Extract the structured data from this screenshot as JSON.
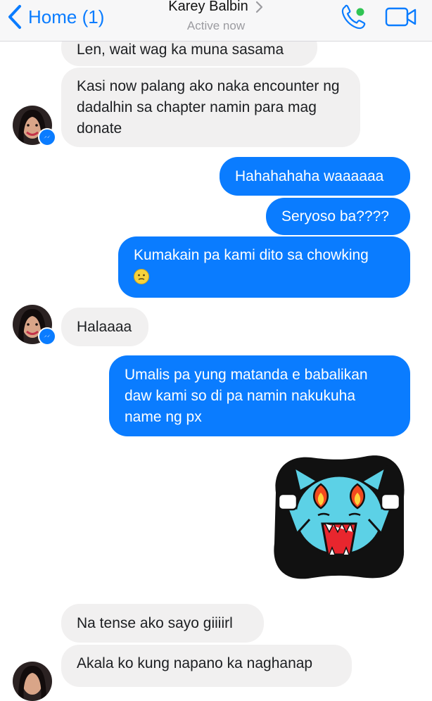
{
  "header": {
    "back_label": "Home (1)",
    "contact_name": "Karey Balbin",
    "status": "Active now"
  },
  "messages": [
    {
      "dir": "in",
      "text": "Len, wait wag ka muna sasama"
    },
    {
      "dir": "in",
      "text": "Kasi now palang ako naka encounter ng dadalhin sa chapter namin para mag donate"
    },
    {
      "dir": "out",
      "text": "Hahahahaha waaaaaa"
    },
    {
      "dir": "out",
      "text": "Seryoso ba????"
    },
    {
      "dir": "out",
      "text": "Kumakain pa kami dito sa chowking",
      "emoji": "confused-face"
    },
    {
      "dir": "in",
      "text": "Halaaaa"
    },
    {
      "dir": "out",
      "text": "Umalis pa yung matanda e babalikan daw kami so di pa namin nakukuha name ng px"
    },
    {
      "dir": "out",
      "sticker": "angry-cat-fire-eyes-sticker"
    },
    {
      "dir": "in",
      "text": "Na tense ako sayo giiiirl"
    },
    {
      "dir": "in",
      "text": "Akala ko kung napano ka naghanap"
    }
  ],
  "colors": {
    "accent": "#0a7cff",
    "incoming_bubble": "#f1f0f0",
    "online_dot": "#31c454"
  }
}
